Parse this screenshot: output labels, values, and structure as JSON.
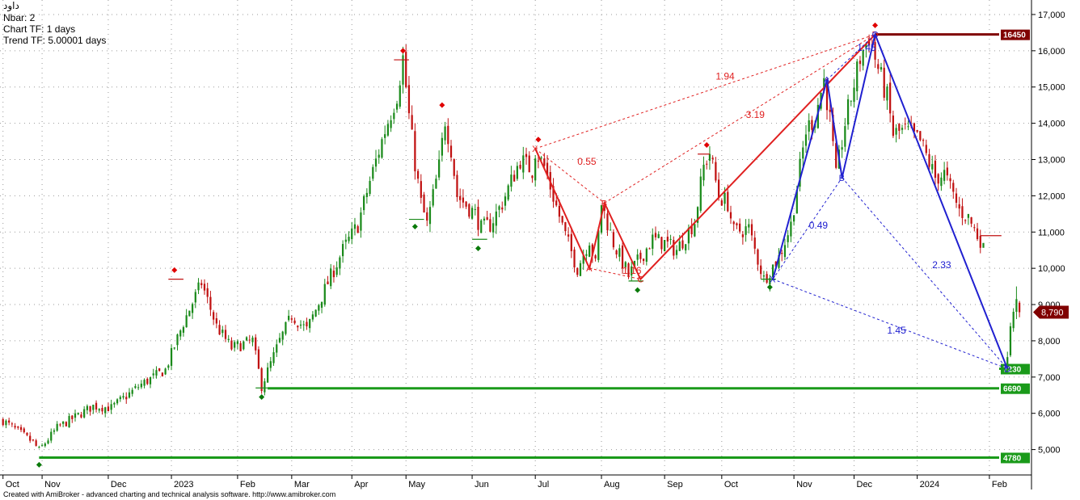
{
  "info": {
    "symbol": "داود",
    "nbar": "Nbar: 2",
    "chart_tf": "Chart TF: 1 days",
    "trend_tf": "Trend TF: 5.00001 days"
  },
  "footer": "Created with AmiBroker - advanced charting and technical analysis software. http://www.amibroker.com",
  "colors": {
    "up": "#1a8a1a",
    "down": "#c01010",
    "red_pattern": "#e02020",
    "blue_pattern": "#2020d0",
    "support": "#1a9a1a",
    "resistance": "#800000",
    "last_price_tag": "#800000",
    "grid": "#9a9a9a"
  },
  "chart_data": {
    "type": "candlestick",
    "y_range": [
      4300,
      17400
    ],
    "y_ticks": [
      {
        "v": 5000,
        "label": "5,000"
      },
      {
        "v": 6000,
        "label": "6,000"
      },
      {
        "v": 7000,
        "label": "7,000"
      },
      {
        "v": 8000,
        "label": "8,000"
      },
      {
        "v": 9000,
        "label": "9,000"
      },
      {
        "v": 10000,
        "label": "10,000"
      },
      {
        "v": 11000,
        "label": "11,000"
      },
      {
        "v": 12000,
        "label": "12,000"
      },
      {
        "v": 13000,
        "label": "13,000"
      },
      {
        "v": 14000,
        "label": "14,000"
      },
      {
        "v": 15000,
        "label": "15,000"
      },
      {
        "v": 16000,
        "label": "16,000"
      },
      {
        "v": 17000,
        "label": "17,000"
      }
    ],
    "x_labels": [
      {
        "t": 0,
        "label": "Oct"
      },
      {
        "t": 13,
        "label": "Nov"
      },
      {
        "t": 35,
        "label": "Dec"
      },
      {
        "t": 56,
        "label": "2023"
      },
      {
        "t": 78,
        "label": "Feb"
      },
      {
        "t": 96,
        "label": "Mar"
      },
      {
        "t": 116,
        "label": "Apr"
      },
      {
        "t": 134,
        "label": "May"
      },
      {
        "t": 156,
        "label": "Jun"
      },
      {
        "t": 177,
        "label": "Jul"
      },
      {
        "t": 199,
        "label": "Aug"
      },
      {
        "t": 220,
        "label": "Sep"
      },
      {
        "t": 239,
        "label": "Oct"
      },
      {
        "t": 263,
        "label": "Nov"
      },
      {
        "t": 283,
        "label": "Dec"
      },
      {
        "t": 304,
        "label": "2024"
      },
      {
        "t": 328,
        "label": "Feb"
      }
    ],
    "x_gridlines": [
      0,
      13,
      35,
      56,
      78,
      96,
      116,
      134,
      156,
      177,
      199,
      220,
      239,
      263,
      283,
      304,
      328
    ],
    "trajectory": [
      [
        0,
        5800
      ],
      [
        10,
        5200
      ],
      [
        12,
        4980
      ],
      [
        18,
        5600
      ],
      [
        30,
        6200
      ],
      [
        36,
        6150
      ],
      [
        46,
        6800
      ],
      [
        54,
        7200
      ],
      [
        60,
        8500
      ],
      [
        66,
        9600
      ],
      [
        71,
        8400
      ],
      [
        76,
        7800
      ],
      [
        83,
        8000
      ],
      [
        86,
        6750
      ],
      [
        92,
        8000
      ],
      [
        96,
        8700
      ],
      [
        101,
        8300
      ],
      [
        108,
        9600
      ],
      [
        113,
        10500
      ],
      [
        118,
        11200
      ],
      [
        122,
        12400
      ],
      [
        127,
        13800
      ],
      [
        131,
        14800
      ],
      [
        133,
        15800
      ],
      [
        135,
        14200
      ],
      [
        137,
        12900
      ],
      [
        139,
        11800
      ],
      [
        141,
        11200
      ],
      [
        145,
        12800
      ],
      [
        147,
        14100
      ],
      [
        149,
        13300
      ],
      [
        151,
        12000
      ],
      [
        157,
        11500
      ],
      [
        159,
        11100
      ],
      [
        162,
        11200
      ],
      [
        166,
        11800
      ],
      [
        172,
        13000
      ],
      [
        176,
        12700
      ],
      [
        177,
        13250
      ],
      [
        180,
        12800
      ],
      [
        184,
        11700
      ],
      [
        187,
        10900
      ],
      [
        191,
        10000
      ],
      [
        195,
        10800
      ],
      [
        197,
        10100
      ],
      [
        199,
        11800
      ],
      [
        203,
        10700
      ],
      [
        208,
        9800
      ],
      [
        212,
        10300
      ],
      [
        216,
        10800
      ],
      [
        220,
        10700
      ],
      [
        224,
        10500
      ],
      [
        230,
        11300
      ],
      [
        233,
        12800
      ],
      [
        235,
        13200
      ],
      [
        238,
        12000
      ],
      [
        241,
        11800
      ],
      [
        243,
        11000
      ],
      [
        248,
        11100
      ],
      [
        250,
        10500
      ],
      [
        253,
        9700
      ],
      [
        258,
        10300
      ],
      [
        262,
        11200
      ],
      [
        267,
        13800
      ],
      [
        270,
        14200
      ],
      [
        273,
        15200
      ],
      [
        275,
        14100
      ],
      [
        277,
        12500
      ],
      [
        280,
        14000
      ],
      [
        285,
        15800
      ],
      [
        288,
        16400
      ],
      [
        291,
        15500
      ],
      [
        294,
        14700
      ],
      [
        296,
        13700
      ],
      [
        300,
        13800
      ],
      [
        305,
        13500
      ],
      [
        310,
        12500
      ],
      [
        313,
        12600
      ],
      [
        318,
        11600
      ],
      [
        321,
        11400
      ],
      [
        324,
        10900
      ],
      [
        326,
        10700
      ]
    ],
    "gap_bars": [
      {
        "t": 334,
        "o": 7300,
        "h": 7700,
        "l": 7200,
        "c": 7550
      },
      {
        "t": 335,
        "o": 7600,
        "h": 8500,
        "l": 7550,
        "c": 8400
      },
      {
        "t": 336,
        "o": 8350,
        "h": 8900,
        "l": 8250,
        "c": 8800
      },
      {
        "t": 337,
        "o": 8800,
        "h": 9500,
        "l": 8600,
        "c": 9150
      },
      {
        "t": 338,
        "o": 9050,
        "h": 9100,
        "l": 8650,
        "c": 8790
      }
    ],
    "swing_high_markers": [
      {
        "t": 57,
        "v": 9950
      },
      {
        "t": 133,
        "v": 16000
      },
      {
        "t": 146,
        "v": 14500
      },
      {
        "t": 178,
        "v": 13550
      },
      {
        "t": 234,
        "v": 13400
      },
      {
        "t": 290,
        "v": 16700
      }
    ],
    "swing_low_markers": [
      {
        "t": 12,
        "v": 4580
      },
      {
        "t": 86,
        "v": 6450
      },
      {
        "t": 137,
        "v": 11150
      },
      {
        "t": 158,
        "v": 10550
      },
      {
        "t": 211,
        "v": 9400
      },
      {
        "t": 255,
        "v": 9480
      }
    ],
    "horizontal_levels": [
      {
        "name": "support-4780",
        "value": 4780,
        "label": "4780",
        "color": "#1a9a1a",
        "t_start": 12,
        "t_end": 342
      },
      {
        "name": "support-6690",
        "value": 6690,
        "label": "6690",
        "color": "#1a9a1a",
        "t_start": 88,
        "t_end": 342
      },
      {
        "name": "support-7230",
        "value": 7230,
        "label": "7230",
        "color": "#1a9a1a",
        "t_start": 334,
        "t_end": 342
      },
      {
        "name": "resistance-16450",
        "value": 16450,
        "label": "16450",
        "color": "#800000",
        "t_start": 290,
        "t_end": 342
      }
    ],
    "last_price": {
      "value": 8790,
      "label": "8,790"
    },
    "red_pattern": {
      "points": [
        {
          "name": "X",
          "t": 177,
          "v": 13300
        },
        {
          "name": "A",
          "t": 195,
          "v": 10000
        },
        {
          "name": "B",
          "t": 200,
          "v": 11800
        },
        {
          "name": "C",
          "t": 212,
          "v": 9700
        },
        {
          "name": "D",
          "t": 290,
          "v": 16450
        }
      ],
      "ratios": [
        {
          "text": "0.55",
          "t": 191,
          "v": 12850
        },
        {
          "text": "1.16",
          "t": 206,
          "v": 9850
        },
        {
          "text": "3.19",
          "t": 247,
          "v": 14150
        },
        {
          "text": "1.94",
          "t": 237,
          "v": 15200
        }
      ],
      "dashed_pairs": [
        [
          "X",
          "B"
        ],
        [
          "A",
          "C"
        ],
        [
          "B",
          "D"
        ],
        [
          "X",
          "D"
        ]
      ]
    },
    "blue_pattern": {
      "points": [
        {
          "name": "X",
          "t": 256,
          "v": 9700
        },
        {
          "name": "A",
          "t": 274,
          "v": 15200
        },
        {
          "name": "B",
          "t": 279,
          "v": 12500
        },
        {
          "name": "C",
          "t": 290,
          "v": 16450
        },
        {
          "name": "D",
          "t": 334,
          "v": 7230
        }
      ],
      "ratios": [
        {
          "text": "0.49",
          "t": 268,
          "v": 11100
        },
        {
          "text": "1.45",
          "t": 284,
          "v": 16000
        },
        {
          "text": "2.33",
          "t": 309,
          "v": 10000
        },
        {
          "text": "1.45",
          "t": 294,
          "v": 8200
        }
      ],
      "dashed_pairs": [
        [
          "X",
          "B"
        ],
        [
          "A",
          "C"
        ],
        [
          "B",
          "D"
        ],
        [
          "X",
          "D"
        ]
      ]
    },
    "small_level_marks": [
      {
        "t": 130,
        "t2": 135,
        "v": 15750,
        "color": "#c01010"
      },
      {
        "t": 231,
        "t2": 235,
        "v": 13150,
        "color": "#c01010"
      },
      {
        "t": 55,
        "t2": 60,
        "v": 9700,
        "color": "#c01010"
      },
      {
        "t": 135,
        "t2": 140,
        "v": 11350,
        "color": "#1a8a1a"
      },
      {
        "t": 156,
        "t2": 161,
        "v": 10800,
        "color": "#1a8a1a"
      },
      {
        "t": 208,
        "t2": 213,
        "v": 9650,
        "color": "#1a8a1a"
      },
      {
        "t": 252,
        "t2": 257,
        "v": 9700,
        "color": "#1a8a1a"
      },
      {
        "t": 84,
        "t2": 88,
        "v": 6700,
        "color": "#1a8a1a"
      },
      {
        "t": 325,
        "t2": 332,
        "v": 10900,
        "color": "#c01010"
      }
    ]
  }
}
